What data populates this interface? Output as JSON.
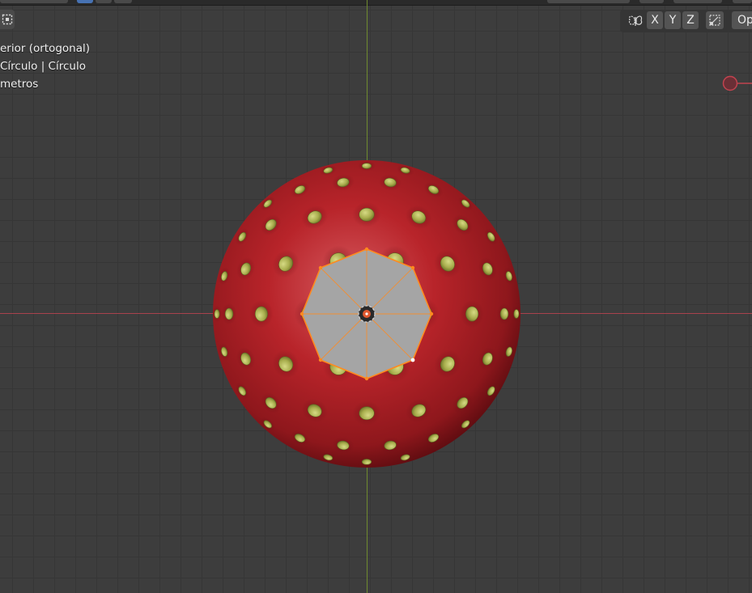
{
  "viewport": {
    "view_name": "erior (ortogonal)",
    "object_info": "Círculo | Círculo",
    "units": "metros"
  },
  "header": {
    "axis_buttons": [
      "X",
      "Y",
      "Z"
    ],
    "options_label": "Op"
  },
  "icons": {
    "toolbar_toggle": "toolbar-toggle-icon",
    "mirror": "butterfly-mirror-icon",
    "snap": "snap-icon",
    "object_origin": "object-origin-icon"
  },
  "colors": {
    "grid_bg": "#3d3d3d",
    "x_axis": "#a8424d",
    "y_axis": "#6f8a2f",
    "mesh_red": "#b8242a",
    "seeds": "#a7ad4c",
    "selection": "#ff8a1e",
    "face_fill": "#a5a5a5"
  }
}
